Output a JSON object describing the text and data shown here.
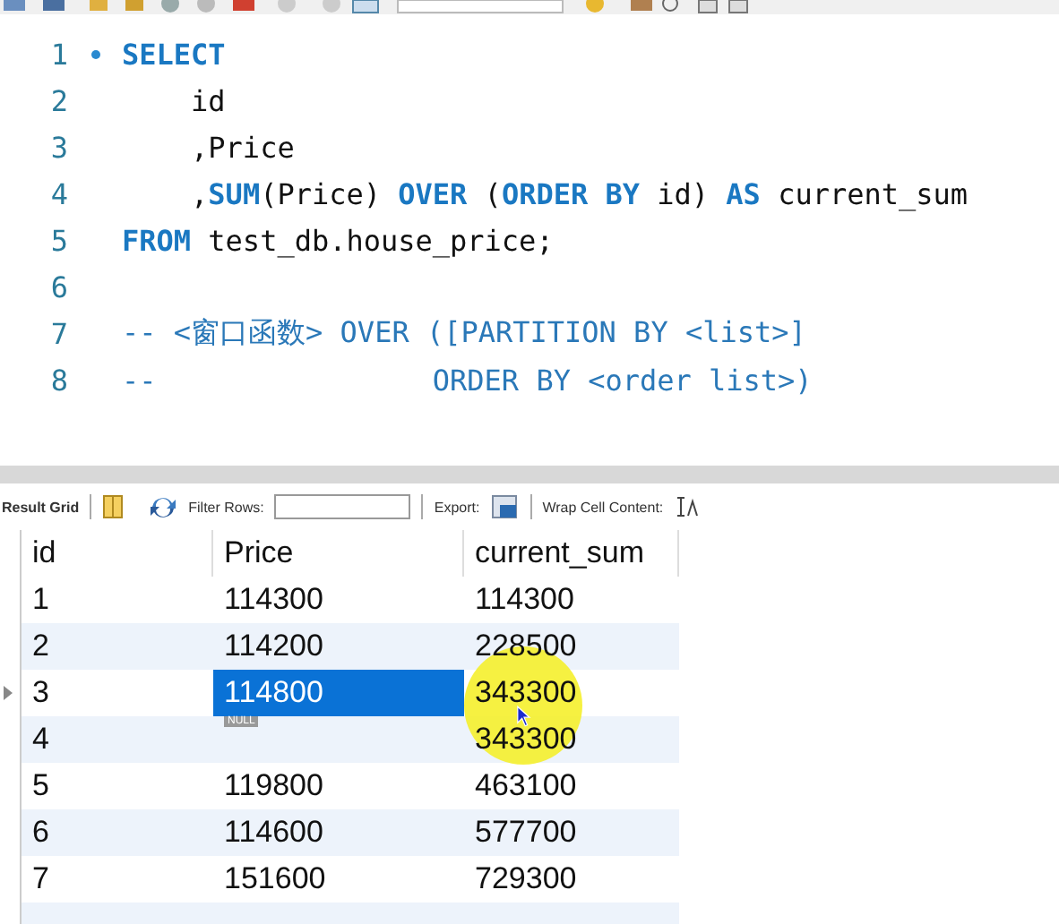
{
  "editor": {
    "lines": [
      {
        "number": "1",
        "marker": true,
        "tokens": [
          {
            "text": "SELECT",
            "kind": "keyword"
          }
        ]
      },
      {
        "number": "2",
        "marker": false,
        "tokens": [
          {
            "text": "    id",
            "kind": "plain"
          }
        ]
      },
      {
        "number": "3",
        "marker": false,
        "tokens": [
          {
            "text": "    ,Price",
            "kind": "plain"
          }
        ]
      },
      {
        "number": "4",
        "marker": false,
        "tokens": [
          {
            "text": "    ,",
            "kind": "plain"
          },
          {
            "text": "SUM",
            "kind": "keyword"
          },
          {
            "text": "(Price) ",
            "kind": "plain"
          },
          {
            "text": "OVER",
            "kind": "keyword"
          },
          {
            "text": " (",
            "kind": "plain"
          },
          {
            "text": "ORDER BY",
            "kind": "keyword"
          },
          {
            "text": " id) ",
            "kind": "plain"
          },
          {
            "text": "AS",
            "kind": "keyword"
          },
          {
            "text": " current_sum",
            "kind": "plain"
          }
        ]
      },
      {
        "number": "5",
        "marker": false,
        "tokens": [
          {
            "text": "FROM",
            "kind": "keyword"
          },
          {
            "text": " test_db.house_price;",
            "kind": "plain"
          }
        ]
      },
      {
        "number": "6",
        "marker": false
      },
      {
        "number": "7",
        "marker": false,
        "tokens": [
          {
            "text": "-- <窗口函数> OVER ([PARTITION BY <list>]",
            "kind": "comment"
          }
        ]
      },
      {
        "number": "8",
        "marker": false,
        "tokens": [
          {
            "text": "--                ORDER BY <order list>)",
            "kind": "comment"
          }
        ]
      }
    ]
  },
  "result_toolbar": {
    "title": "Result Grid",
    "filter_label": "Filter Rows:",
    "export_label": "Export:",
    "wrap_label": "Wrap Cell Content:"
  },
  "grid": {
    "columns": [
      "id",
      "Price",
      "current_sum"
    ],
    "rows": [
      {
        "current": false,
        "cells": [
          {
            "text": "1",
            "selected": false
          },
          {
            "text": "114300",
            "selected": false
          },
          {
            "text": "114300",
            "selected": false
          }
        ]
      },
      {
        "current": false,
        "cells": [
          {
            "text": "2",
            "selected": false
          },
          {
            "text": "114200",
            "selected": false
          },
          {
            "text": "228500",
            "selected": false
          }
        ]
      },
      {
        "current": true,
        "cells": [
          {
            "text": "3",
            "selected": false
          },
          {
            "text": "114800",
            "selected": true
          },
          {
            "text": "343300",
            "selected": false
          }
        ]
      },
      {
        "current": false,
        "cells": [
          {
            "text": "4",
            "selected": false
          },
          {
            "text": "NULL",
            "selected": false,
            "kind": "null"
          },
          {
            "text": "343300",
            "selected": false
          }
        ]
      },
      {
        "current": false,
        "cells": [
          {
            "text": "5",
            "selected": false
          },
          {
            "text": "119800",
            "selected": false
          },
          {
            "text": "463100",
            "selected": false
          }
        ]
      },
      {
        "current": false,
        "cells": [
          {
            "text": "6",
            "selected": false
          },
          {
            "text": "114600",
            "selected": false
          },
          {
            "text": "577700",
            "selected": false
          }
        ]
      },
      {
        "current": false,
        "cells": [
          {
            "text": "7",
            "selected": false
          },
          {
            "text": "151600",
            "selected": false
          },
          {
            "text": "729300",
            "selected": false
          }
        ]
      }
    ]
  }
}
